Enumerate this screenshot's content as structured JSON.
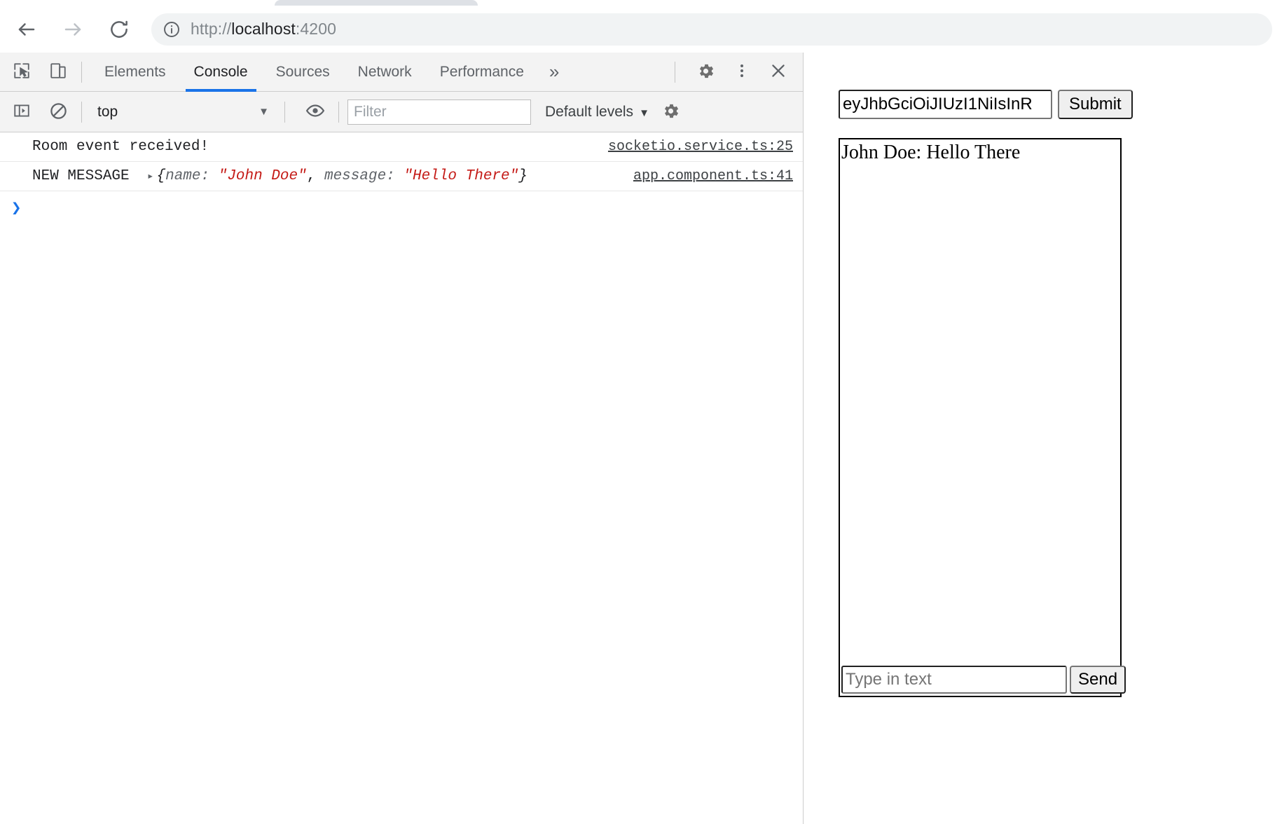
{
  "browser": {
    "nav": {
      "back_icon": "arrow-left-icon",
      "forward_icon": "arrow-right-icon",
      "reload_icon": "reload-icon"
    },
    "omnibox": {
      "info_icon": "info-circle-icon",
      "scheme": "http://",
      "host": "localhost",
      "port": ":4200",
      "full_url": "http://localhost:4200"
    }
  },
  "devtools": {
    "toolbar": {
      "inspect_icon": "inspect-cursor-icon",
      "device_toolbar_icon": "device-toggle-icon",
      "settings_icon": "gear-icon",
      "more_icon": "kebab-menu-icon",
      "close_icon": "close-icon",
      "more_tabs_label": "»"
    },
    "tabs": [
      {
        "label": "Elements",
        "active": false
      },
      {
        "label": "Console",
        "active": true
      },
      {
        "label": "Sources",
        "active": false
      },
      {
        "label": "Network",
        "active": false
      },
      {
        "label": "Performance",
        "active": false
      }
    ],
    "console_toolbar": {
      "sidebar_icon": "console-sidebar-icon",
      "clear_icon": "clear-console-icon",
      "context_value": "top",
      "context_caret": "▼",
      "eye_icon": "live-expression-eye-icon",
      "filter_placeholder": "Filter",
      "filter_value": "",
      "levels_label": "Default levels",
      "levels_caret": "▼",
      "settings_icon": "gear-icon"
    },
    "messages": [
      {
        "type": "text",
        "text": "Room event received!",
        "source": "socketio.service.ts:25"
      },
      {
        "type": "object",
        "label": "NEW MESSAGE",
        "disclosure": "▸",
        "open_brace": "{",
        "key1": "name:",
        "value1": "\"John Doe\"",
        "comma": ",",
        "key2": "message:",
        "value2": "\"Hello There\"",
        "close_brace": "}",
        "source": "app.component.ts:41"
      }
    ],
    "prompt_chevron": "❯"
  },
  "app": {
    "token_input_value": "eyJhbGciOiJIUzI1NiIsInR",
    "token_input_placeholder": "",
    "submit_label": "Submit",
    "chat_messages": [
      "John Doe: Hello There"
    ],
    "chat_input_value": "",
    "chat_input_placeholder": "Type in text",
    "send_label": "Send"
  },
  "colors": {
    "accent_blue": "#1a73e8",
    "console_string_red": "#c41a16",
    "toolbar_gray": "#f3f3f3",
    "omnibox_gray": "#f1f3f4"
  }
}
